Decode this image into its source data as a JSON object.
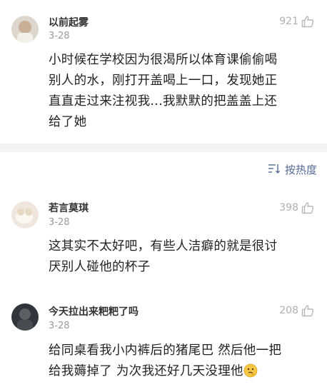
{
  "comments": [
    {
      "username": "以前起雾",
      "date": "3-28",
      "likes": "921",
      "lines": [
        "小时候在学校因为很渴所以体育课偷偷喝",
        "别人的水，刚打开盖喝上一口，发现她正",
        "直直走过来注视我...我默默的把盖盖上还",
        "给了她"
      ]
    },
    {
      "username": "若言莫琪",
      "date": "3-28",
      "likes": "398",
      "lines": [
        "这其实不太好吧，有些人洁癖的就是很讨",
        "厌别人碰他的杯子"
      ]
    },
    {
      "username": "今天拉出来粑粑了吗",
      "date": "3-28",
      "likes": "208",
      "lines": [
        "给同桌看我小内裤后的猪尾巴  然后他一把",
        "给我薅掉了  为次我还好几天没理他"
      ]
    }
  ],
  "sort": {
    "label": "按热度",
    "icon": "sort-icon"
  },
  "colors": {
    "link": "#536a94",
    "muted": "#9a9a9a",
    "divider": "#f3f3f3"
  }
}
